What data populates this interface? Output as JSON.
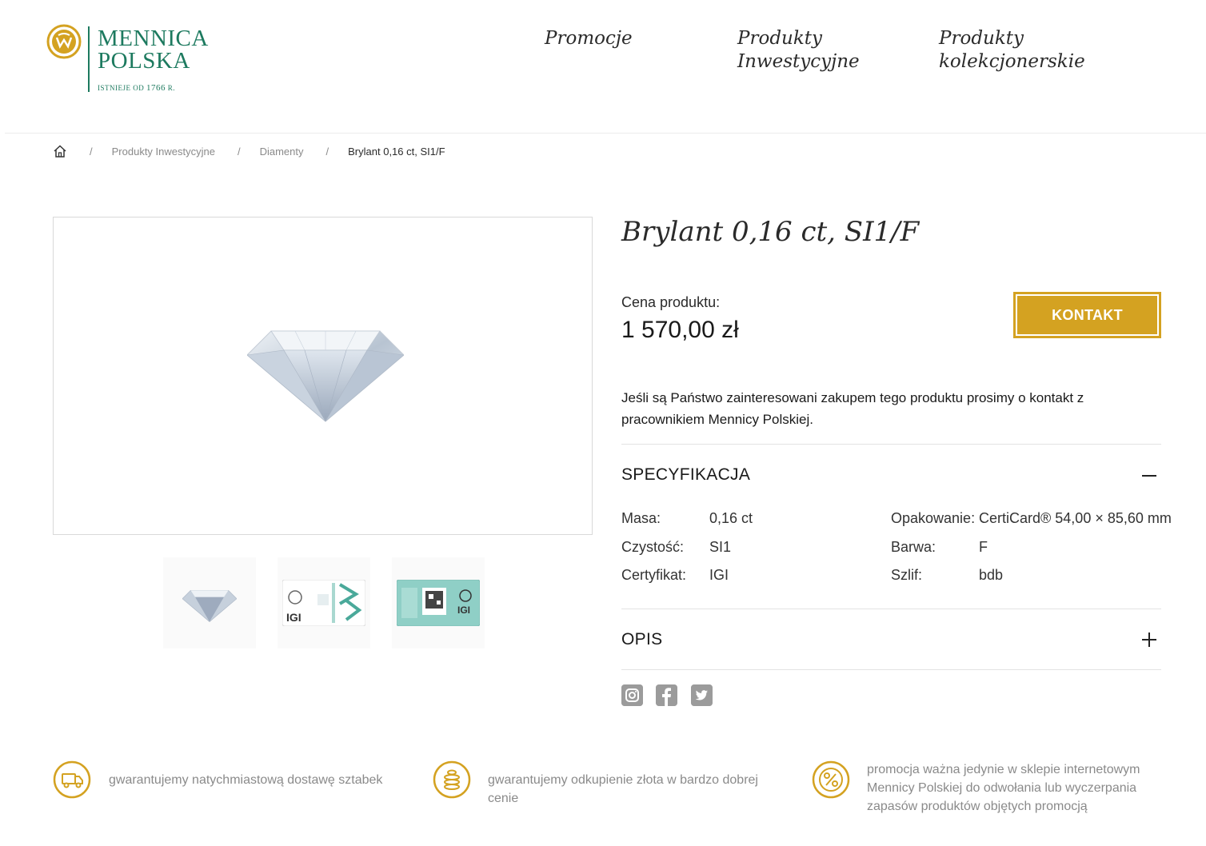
{
  "header": {
    "logo": {
      "line1": "MENNICA",
      "line2": "POLSKA",
      "tagline_prefix": "ISTNIEJE OD",
      "tagline_year": "1766",
      "tagline_suffix": "R."
    },
    "nav": [
      {
        "label": "Promocje"
      },
      {
        "label": "Produkty\nInwestycyjne"
      },
      {
        "label": "Produkty\nkolekcjonerskie"
      }
    ]
  },
  "breadcrumb": {
    "items": [
      "Produkty Inwestycyjne",
      "Diamenty"
    ],
    "current": "Brylant 0,16 ct, SI1/F",
    "separator": "/"
  },
  "product": {
    "title": "Brylant 0,16 ct, SI1/F",
    "price_label": "Cena produktu:",
    "price": "1 570,00 zł",
    "contact_button": "KONTAKT",
    "info": "Jeśli są Państwo zainteresowani zakupem tego produktu prosimy o kontakt z pracownikiem Mennicy Polskiej.",
    "specs_title": "SPECYFIKACJA",
    "specs_toggle": "−",
    "specs": {
      "left": [
        {
          "label": "Masa:",
          "value": "0,16 ct"
        },
        {
          "label": "Czystość:",
          "value": "SI1"
        },
        {
          "label": "Certyfikat:",
          "value": "IGI"
        }
      ],
      "right": [
        {
          "label": "Opakowanie:",
          "value": "CertiCard® 54,00 × 85,60 mm"
        },
        {
          "label": "Barwa:",
          "value": "F"
        },
        {
          "label": "Szlif:",
          "value": "bdb"
        }
      ]
    },
    "description_title": "OPIS",
    "description_toggle": "+",
    "thumbnails": [
      "diamond",
      "igi-card-front",
      "igi-card-back"
    ],
    "thumb_labels": [
      "IGI",
      "IGI"
    ],
    "social": [
      "instagram-icon",
      "facebook-icon",
      "twitter-icon"
    ]
  },
  "features": [
    {
      "icon": "delivery-truck-icon",
      "text": "gwarantujemy natychmiastową dostawę sztabek"
    },
    {
      "icon": "coins-stack-icon",
      "text": "gwarantujemy odkupienie złota w bardzo dobrej cenie"
    },
    {
      "icon": "percent-icon",
      "text": "promocja ważna jedynie w sklepie internetowym Mennicy Polskiej do odwołania lub wyczerpania zapasów produktów objętych promocją"
    }
  ],
  "colors": {
    "brand_green": "#1d7a5f",
    "gold": "#d4a221",
    "text_gray": "#8a8a8a"
  }
}
